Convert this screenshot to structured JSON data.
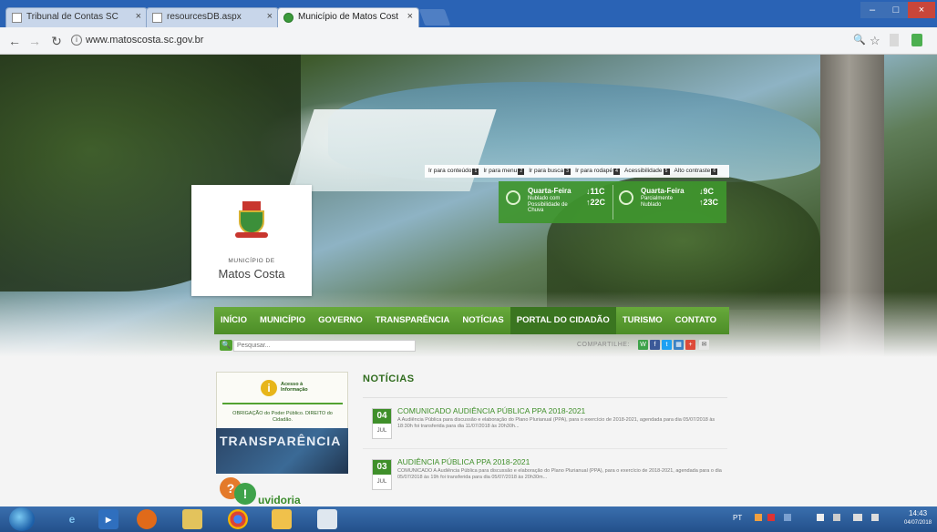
{
  "browser": {
    "tabs": [
      {
        "title": "Tribunal de Contas SC"
      },
      {
        "title": "resourcesDB.aspx"
      },
      {
        "title": "Município de Matos Cost"
      }
    ],
    "tab_close": "×",
    "url": "www.matoscosta.sc.gov.br",
    "info_icon": "i",
    "window_controls": {
      "min": "–",
      "max": "□",
      "close": "×"
    },
    "nav_icons": {
      "back": "←",
      "forward": "→",
      "reload": "↻"
    },
    "toolbar_icons": {
      "zoom": "🔍",
      "star": "☆"
    }
  },
  "accessibility_bar": {
    "items": [
      {
        "label": "Ir para conteúdo",
        "key": "1"
      },
      {
        "label": "Ir para menu",
        "key": "2"
      },
      {
        "label": "Ir para busca",
        "key": "3"
      },
      {
        "label": "Ir para rodapé",
        "key": "4"
      },
      {
        "label": "Acessibilidade",
        "key": "5"
      },
      {
        "label": "Alto contraste",
        "key": "6"
      }
    ]
  },
  "weather": [
    {
      "day": "Quarta-Feira",
      "condition": "Nublado com Possibilidade de Chuva",
      "min": "↓11C",
      "max": "↑22C"
    },
    {
      "day": "Quarta-Feira",
      "condition": "Parcialmente Nublado",
      "min": "↓9C",
      "max": "↑23C"
    }
  ],
  "logo": {
    "small": "MUNICÍPIO DE",
    "big": "Matos Costa"
  },
  "nav": {
    "items": [
      "INÍCIO",
      "MUNICÍPIO",
      "GOVERNO",
      "TRANSPARÊNCIA",
      "NOTÍCIAS",
      "PORTAL DO CIDADÃO",
      "TURISMO",
      "CONTATO"
    ],
    "active_index": 5
  },
  "search": {
    "placeholder": "Pesquisar...",
    "icon": "🔍"
  },
  "share": {
    "label": "COMPARTILHE:",
    "buttons": [
      {
        "letter": "W",
        "color": "#3ea24a"
      },
      {
        "letter": "f",
        "color": "#3b5998"
      },
      {
        "letter": "t",
        "color": "#1da1f2"
      },
      {
        "letter": "▦",
        "color": "#3b82c4"
      },
      {
        "letter": "+",
        "color": "#dd4b39"
      },
      {
        "letter": "✉",
        "color": "#e6e6e6"
      }
    ]
  },
  "sidebar": {
    "banner1": {
      "icon": "i",
      "title": "Acesso à Informação",
      "subtitle": "OBRIGAÇÃO do Poder Público. DIREITO do Cidadão."
    },
    "banner2": {
      "title": "TRANSPARÊNCIA"
    },
    "banner3": {
      "q": "?",
      "excl": "!",
      "title": "uvidoria"
    }
  },
  "news": {
    "title": "NOTÍCIAS",
    "items": [
      {
        "day": "04",
        "month": "JUL",
        "headline": "COMUNICADO AUDIÊNCIA PÚBLICA PPA 2018-2021",
        "summary": "A Audiência Pública para discussão e elaboração do Plano Plurianual (PPA), para o exercício de 2018-2021, agendada para dia 05/07/2018 às 18:30h foi transferida para dia 11/07/2018 às 20h30h..."
      },
      {
        "day": "03",
        "month": "JUL",
        "headline": "AUDIÊNCIA PÚBLICA PPA 2018-2021",
        "summary": "COMUNICADO A Audiência Pública para discussão e elaboração do Plano Plurianual (PPA), para o exercício de 2018-2021, agendada para o dia 05/07/2018 às 19h foi transferida para dia 05/07/2018 às 20h30m..."
      }
    ]
  },
  "taskbar": {
    "language": "PT",
    "clock_time": "14:43",
    "clock_date": "04/07/2018"
  },
  "colors": {
    "brand_green": "#4c8d27",
    "nav_active": "#3a7520",
    "news_green": "#3f8f2a"
  }
}
